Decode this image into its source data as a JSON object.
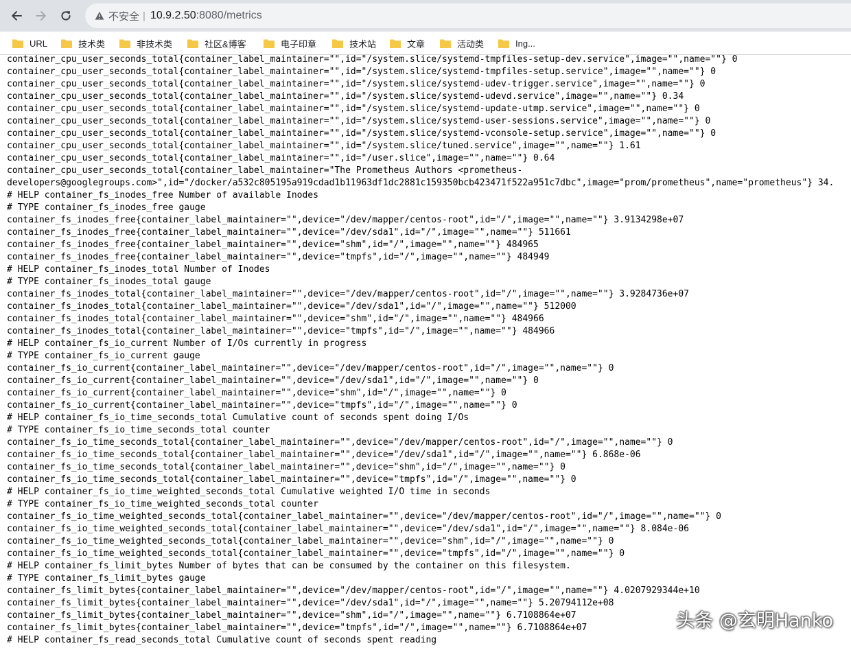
{
  "browser": {
    "security_label": "不安全",
    "url_host": "10.9.2.50",
    "url_path": ":8080/metrics"
  },
  "bookmarks": [
    {
      "label": "URL",
      "icon": "folder-icon"
    },
    {
      "label": "技术类",
      "icon": "folder-icon"
    },
    {
      "label": "非技术类",
      "icon": "folder-icon"
    },
    {
      "label": "社区&博客",
      "icon": "folder-icon"
    },
    {
      "label": "电子印章",
      "icon": "folder-icon"
    },
    {
      "label": "技术站",
      "icon": "folder-icon"
    },
    {
      "label": "文章",
      "icon": "folder-icon"
    },
    {
      "label": "活动类",
      "icon": "folder-icon"
    },
    {
      "label": "Ing...",
      "icon": "folder-icon"
    }
  ],
  "metrics_lines": [
    "container_cpu_user_seconds_total{container_label_maintainer=\"\",id=\"/system.slice/systemd-tmpfiles-setup-dev.service\",image=\"\",name=\"\"} 0",
    "container_cpu_user_seconds_total{container_label_maintainer=\"\",id=\"/system.slice/systemd-tmpfiles-setup.service\",image=\"\",name=\"\"} 0",
    "container_cpu_user_seconds_total{container_label_maintainer=\"\",id=\"/system.slice/systemd-udev-trigger.service\",image=\"\",name=\"\"} 0",
    "container_cpu_user_seconds_total{container_label_maintainer=\"\",id=\"/system.slice/systemd-udevd.service\",image=\"\",name=\"\"} 0.34",
    "container_cpu_user_seconds_total{container_label_maintainer=\"\",id=\"/system.slice/systemd-update-utmp.service\",image=\"\",name=\"\"} 0",
    "container_cpu_user_seconds_total{container_label_maintainer=\"\",id=\"/system.slice/systemd-user-sessions.service\",image=\"\",name=\"\"} 0",
    "container_cpu_user_seconds_total{container_label_maintainer=\"\",id=\"/system.slice/systemd-vconsole-setup.service\",image=\"\",name=\"\"} 0",
    "container_cpu_user_seconds_total{container_label_maintainer=\"\",id=\"/system.slice/tuned.service\",image=\"\",name=\"\"} 1.61",
    "container_cpu_user_seconds_total{container_label_maintainer=\"\",id=\"/user.slice\",image=\"\",name=\"\"} 0.64",
    "container_cpu_user_seconds_total{container_label_maintainer=\"The Prometheus Authors <prometheus-",
    "developers@googlegroups.com>\",id=\"/docker/a532c805195a919cdad1b11963df1dc2881c159350bcb423471f522a951c7dbc\",image=\"prom/prometheus\",name=\"prometheus\"} 34.",
    "# HELP container_fs_inodes_free Number of available Inodes",
    "# TYPE container_fs_inodes_free gauge",
    "container_fs_inodes_free{container_label_maintainer=\"\",device=\"/dev/mapper/centos-root\",id=\"/\",image=\"\",name=\"\"} 3.9134298e+07",
    "container_fs_inodes_free{container_label_maintainer=\"\",device=\"/dev/sda1\",id=\"/\",image=\"\",name=\"\"} 511661",
    "container_fs_inodes_free{container_label_maintainer=\"\",device=\"shm\",id=\"/\",image=\"\",name=\"\"} 484965",
    "container_fs_inodes_free{container_label_maintainer=\"\",device=\"tmpfs\",id=\"/\",image=\"\",name=\"\"} 484949",
    "# HELP container_fs_inodes_total Number of Inodes",
    "# TYPE container_fs_inodes_total gauge",
    "container_fs_inodes_total{container_label_maintainer=\"\",device=\"/dev/mapper/centos-root\",id=\"/\",image=\"\",name=\"\"} 3.9284736e+07",
    "container_fs_inodes_total{container_label_maintainer=\"\",device=\"/dev/sda1\",id=\"/\",image=\"\",name=\"\"} 512000",
    "container_fs_inodes_total{container_label_maintainer=\"\",device=\"shm\",id=\"/\",image=\"\",name=\"\"} 484966",
    "container_fs_inodes_total{container_label_maintainer=\"\",device=\"tmpfs\",id=\"/\",image=\"\",name=\"\"} 484966",
    "# HELP container_fs_io_current Number of I/Os currently in progress",
    "# TYPE container_fs_io_current gauge",
    "container_fs_io_current{container_label_maintainer=\"\",device=\"/dev/mapper/centos-root\",id=\"/\",image=\"\",name=\"\"} 0",
    "container_fs_io_current{container_label_maintainer=\"\",device=\"/dev/sda1\",id=\"/\",image=\"\",name=\"\"} 0",
    "container_fs_io_current{container_label_maintainer=\"\",device=\"shm\",id=\"/\",image=\"\",name=\"\"} 0",
    "container_fs_io_current{container_label_maintainer=\"\",device=\"tmpfs\",id=\"/\",image=\"\",name=\"\"} 0",
    "# HELP container_fs_io_time_seconds_total Cumulative count of seconds spent doing I/Os",
    "# TYPE container_fs_io_time_seconds_total counter",
    "container_fs_io_time_seconds_total{container_label_maintainer=\"\",device=\"/dev/mapper/centos-root\",id=\"/\",image=\"\",name=\"\"} 0",
    "container_fs_io_time_seconds_total{container_label_maintainer=\"\",device=\"/dev/sda1\",id=\"/\",image=\"\",name=\"\"} 6.868e-06",
    "container_fs_io_time_seconds_total{container_label_maintainer=\"\",device=\"shm\",id=\"/\",image=\"\",name=\"\"} 0",
    "container_fs_io_time_seconds_total{container_label_maintainer=\"\",device=\"tmpfs\",id=\"/\",image=\"\",name=\"\"} 0",
    "# HELP container_fs_io_time_weighted_seconds_total Cumulative weighted I/O time in seconds",
    "# TYPE container_fs_io_time_weighted_seconds_total counter",
    "container_fs_io_time_weighted_seconds_total{container_label_maintainer=\"\",device=\"/dev/mapper/centos-root\",id=\"/\",image=\"\",name=\"\"} 0",
    "container_fs_io_time_weighted_seconds_total{container_label_maintainer=\"\",device=\"/dev/sda1\",id=\"/\",image=\"\",name=\"\"} 8.084e-06",
    "container_fs_io_time_weighted_seconds_total{container_label_maintainer=\"\",device=\"shm\",id=\"/\",image=\"\",name=\"\"} 0",
    "container_fs_io_time_weighted_seconds_total{container_label_maintainer=\"\",device=\"tmpfs\",id=\"/\",image=\"\",name=\"\"} 0",
    "# HELP container_fs_limit_bytes Number of bytes that can be consumed by the container on this filesystem.",
    "# TYPE container_fs_limit_bytes gauge",
    "container_fs_limit_bytes{container_label_maintainer=\"\",device=\"/dev/mapper/centos-root\",id=\"/\",image=\"\",name=\"\"} 4.0207929344e+10",
    "container_fs_limit_bytes{container_label_maintainer=\"\",device=\"/dev/sda1\",id=\"/\",image=\"\",name=\"\"} 5.20794112e+08",
    "container_fs_limit_bytes{container_label_maintainer=\"\",device=\"shm\",id=\"/\",image=\"\",name=\"\"} 6.7108864e+07",
    "container_fs_limit_bytes{container_label_maintainer=\"\",device=\"tmpfs\",id=\"/\",image=\"\",name=\"\"} 6.7108864e+07",
    "# HELP container_fs_read_seconds_total Cumulative count of seconds spent reading"
  ],
  "watermark": "头条 @玄明Hanko",
  "colors": {
    "toolbar_bg": "#dee1e6",
    "omnibox_bg": "#f1f3f4",
    "folder_yellow": "#f5c847",
    "text": "#000000"
  }
}
